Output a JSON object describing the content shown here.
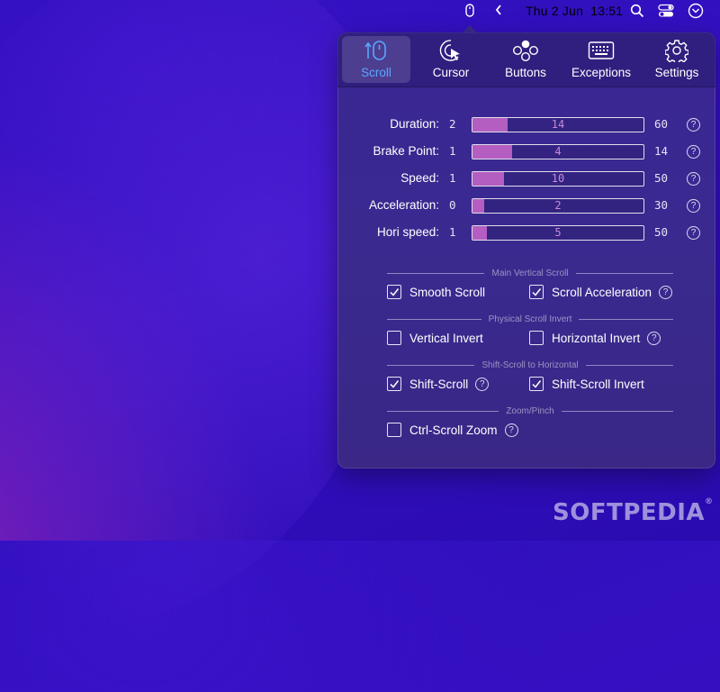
{
  "menubar": {
    "date": "Thu 2 Jun",
    "time": "13:51",
    "icons": [
      "mouse-icon",
      "chevron-left-icon",
      "search-icon",
      "control-center-icon",
      "user-clock-icon"
    ]
  },
  "tabs": [
    {
      "label": "Scroll",
      "icon": "scroll-icon",
      "active": true
    },
    {
      "label": "Cursor",
      "icon": "cursor-icon",
      "active": false
    },
    {
      "label": "Buttons",
      "icon": "buttons-icon",
      "active": false
    },
    {
      "label": "Exceptions",
      "icon": "keyboard-icon",
      "active": false
    },
    {
      "label": "Settings",
      "icon": "gear-icon",
      "active": false
    }
  ],
  "sliders": [
    {
      "label": "Duration:",
      "min": "2",
      "max": "60",
      "value": "14"
    },
    {
      "label": "Brake Point:",
      "min": "1",
      "max": "14",
      "value": "4"
    },
    {
      "label": "Speed:",
      "min": "1",
      "max": "50",
      "value": "10"
    },
    {
      "label": "Acceleration:",
      "min": "0",
      "max": "30",
      "value": "2"
    },
    {
      "label": "Hori speed:",
      "min": "1",
      "max": "50",
      "value": "5"
    }
  ],
  "sections": {
    "main_vertical": "Main Vertical Scroll",
    "physical_invert": "Physical Scroll Invert",
    "shift_scroll": "Shift-Scroll to Horizontal",
    "zoom": "Zoom/Pinch"
  },
  "checkboxes": {
    "smooth_scroll": {
      "label": "Smooth Scroll",
      "checked": true
    },
    "scroll_acceleration": {
      "label": "Scroll Acceleration",
      "checked": true
    },
    "vertical_invert": {
      "label": "Vertical Invert",
      "checked": false
    },
    "horizontal_invert": {
      "label": "Horizontal Invert",
      "checked": false
    },
    "shift_scroll": {
      "label": "Shift-Scroll",
      "checked": true
    },
    "shift_scroll_invert": {
      "label": "Shift-Scroll Invert",
      "checked": true
    },
    "ctrl_scroll_zoom": {
      "label": "Ctrl-Scroll Zoom",
      "checked": false
    }
  },
  "help_glyph": "?",
  "check_glyph": "✓",
  "watermark": "SOFTPEDIA",
  "watermark_mark": "®",
  "colors": {
    "accent": "#5aa8ff",
    "slider_fill": "#b35ec0",
    "slider_text": "#c789d6"
  }
}
